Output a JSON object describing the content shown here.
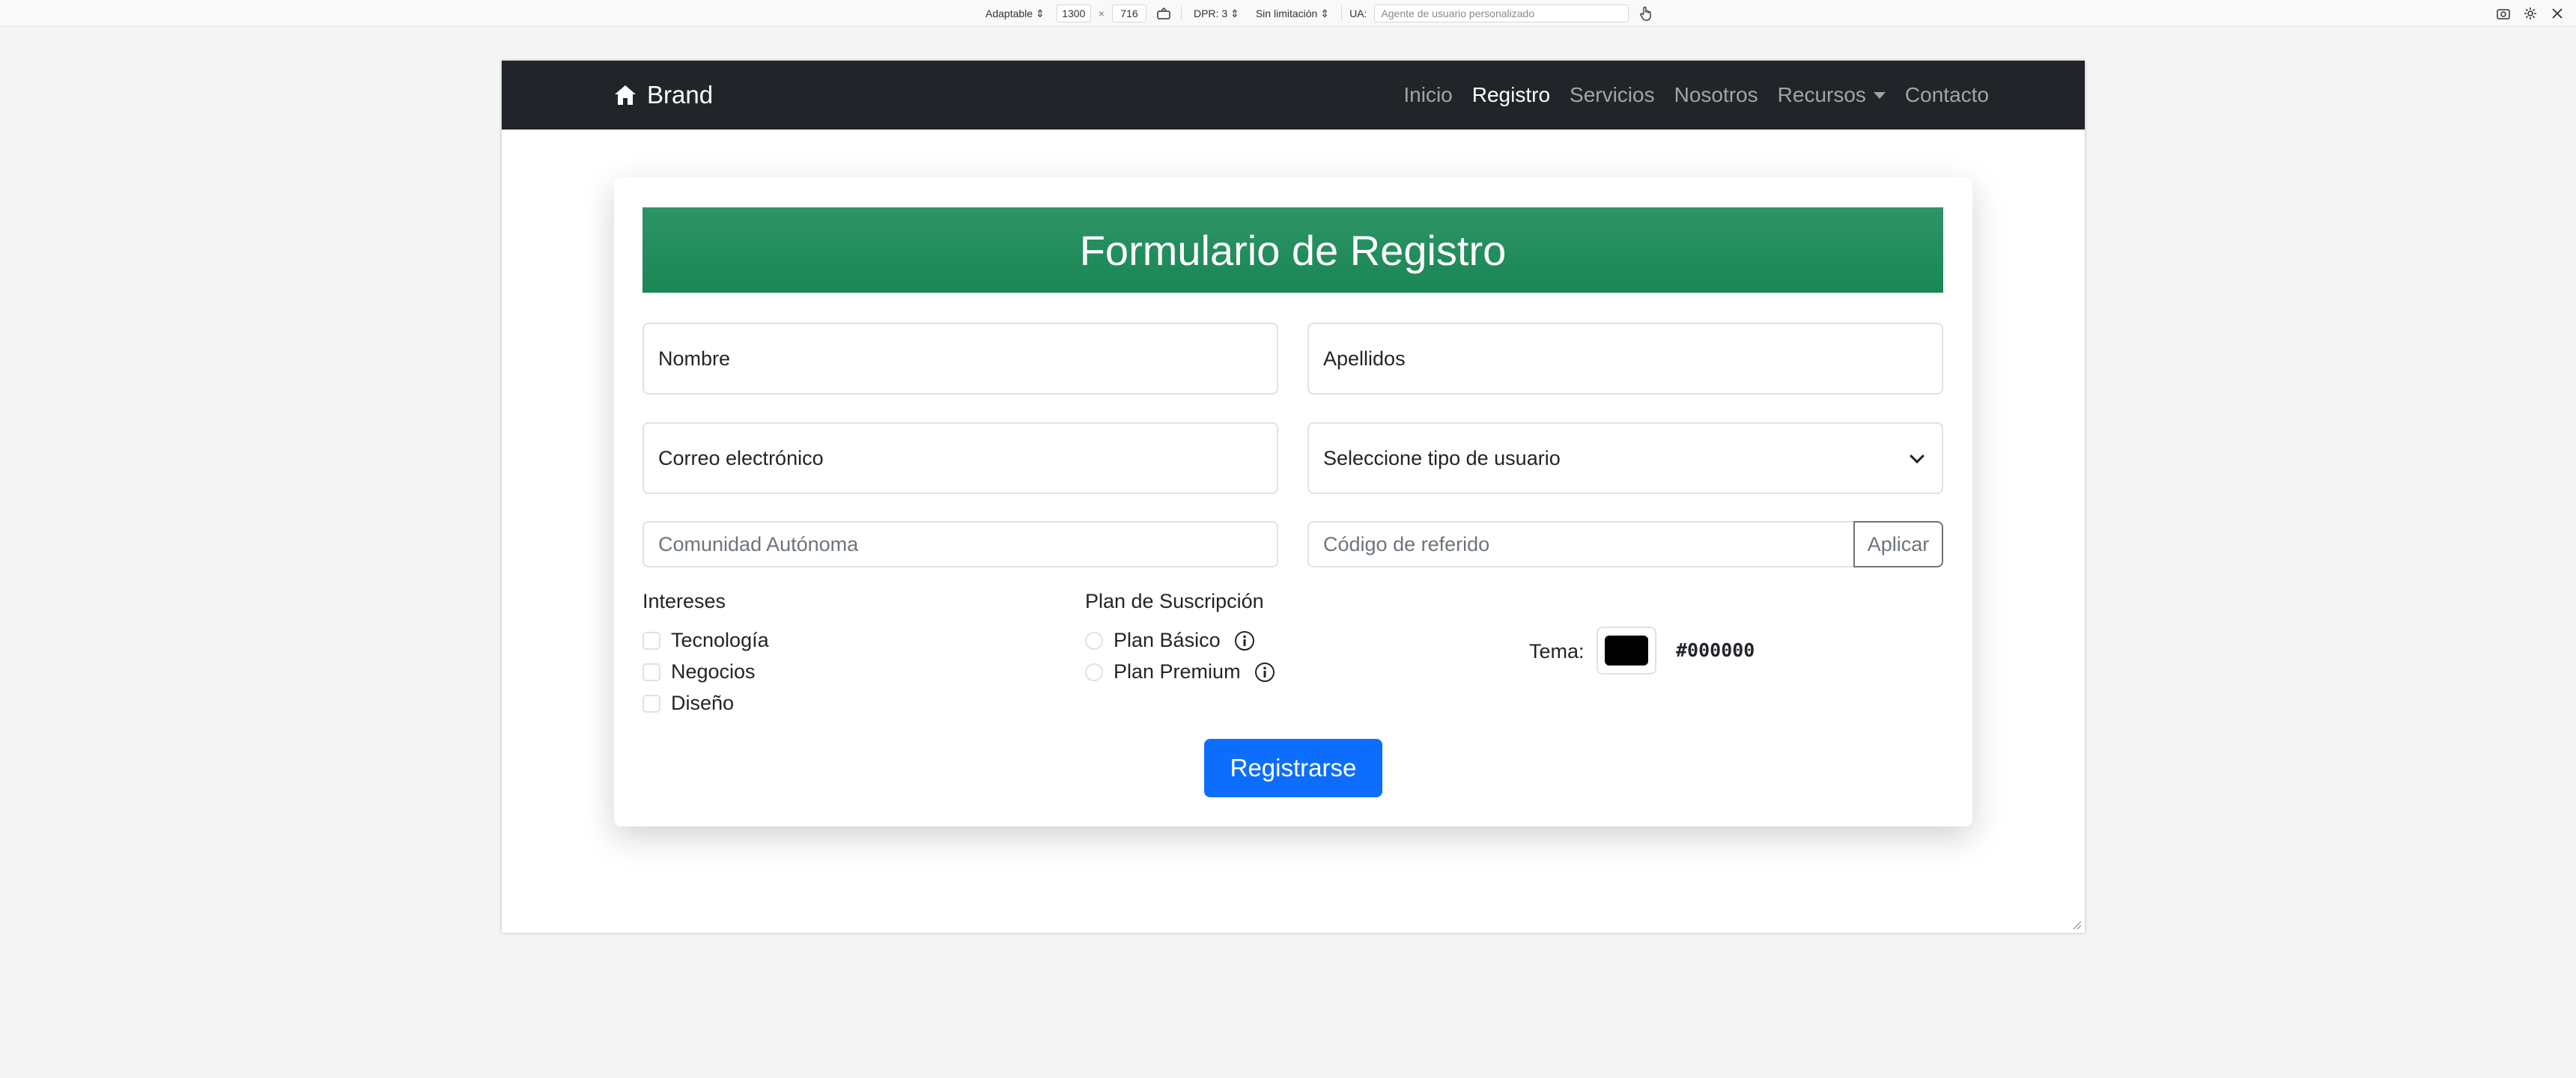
{
  "devtools": {
    "mode": "Adaptable",
    "width": "1300",
    "times": "×",
    "height": "716",
    "dpr": "DPR: 3",
    "throttle": "Sin limitación",
    "ua_label": "UA:",
    "ua_placeholder": "Agente de usuario personalizado"
  },
  "navbar": {
    "brand": "Brand",
    "links": [
      "Inicio",
      "Registro",
      "Servicios",
      "Nosotros",
      "Recursos",
      "Contacto"
    ],
    "active": "Registro"
  },
  "form": {
    "title": "Formulario de Registro",
    "fields": {
      "nombre": "Nombre",
      "apellidos": "Apellidos",
      "correo": "Correo electrónico",
      "tipo_usuario": "Seleccione tipo de usuario",
      "comunidad_placeholder": "Comunidad Autónoma",
      "codigo_placeholder": "Código de referido",
      "aplicar": "Aplicar"
    },
    "intereses": {
      "title": "Intereses",
      "options": [
        "Tecnología",
        "Negocios",
        "Diseño"
      ]
    },
    "plan": {
      "title": "Plan de Suscripción",
      "options": [
        "Plan Básico",
        "Plan Premium"
      ]
    },
    "tema": {
      "label": "Tema:",
      "value": "#000000"
    },
    "submit": "Registrarse"
  },
  "colors": {
    "navbar_bg": "#212529",
    "header_green": "#198754",
    "primary_blue": "#0d6efd"
  }
}
